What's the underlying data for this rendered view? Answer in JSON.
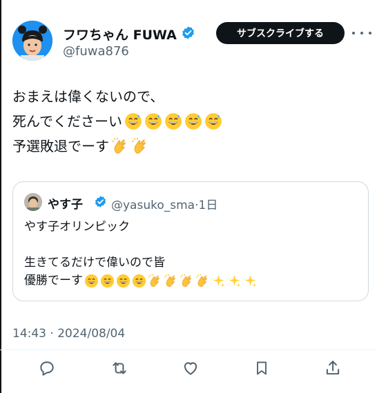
{
  "author": {
    "display_name": "フワちゃん FUWA",
    "handle": "@fuwa876",
    "verified": true,
    "avatar_icon": "user-avatar"
  },
  "subscribe_label": "サブスクライブする",
  "more_icon": "more-horizontal-icon",
  "tweet_lines": [
    {
      "text": "おまえは偉くないので、",
      "emojis": []
    },
    {
      "text": "死んでくださーい",
      "emojis": [
        "😅",
        "😅",
        "😅",
        "😅",
        "😅"
      ]
    },
    {
      "text": "予選敗退でーす",
      "emojis": [
        "👏",
        "👏"
      ]
    }
  ],
  "quote": {
    "display_name": "やす子",
    "handle": "@yasuko_sma",
    "separator": "·",
    "time": "1日",
    "verified": true,
    "lines": [
      {
        "text": "やす子オリンピック",
        "emojis": []
      },
      {
        "text": "",
        "emojis": []
      },
      {
        "text": "生きてるだけで偉いので皆",
        "emojis": []
      },
      {
        "text": "優勝でーす",
        "emojis": [
          "😄",
          "😄",
          "😄",
          "😄",
          "👏",
          "👏",
          "👏",
          "👏",
          "✨",
          "✨",
          "✨"
        ]
      }
    ]
  },
  "timestamp": "14:43 · 2024/08/04",
  "actions": [
    "reply-icon",
    "retweet-icon",
    "like-icon",
    "bookmark-icon",
    "share-icon"
  ],
  "colors": {
    "accent": "#1d9bf0",
    "text": "#0f1419",
    "muted": "#536471",
    "border": "#cfd9de",
    "button_bg": "#0f1419"
  }
}
